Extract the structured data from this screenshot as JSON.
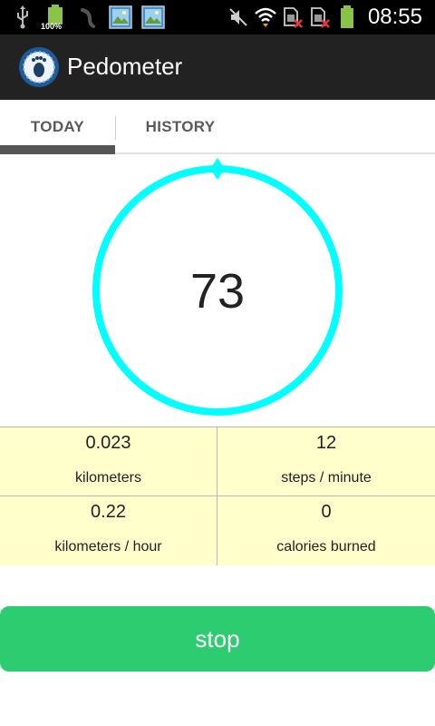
{
  "status_bar": {
    "battery_small_label": "100%",
    "time": "08:55",
    "icons": [
      "usb-icon",
      "battery-full-icon",
      "run-icon",
      "gallery-icon",
      "gallery-icon",
      "mute-icon",
      "wifi-icon",
      "sim-no-signal-icon",
      "sim-no-signal-icon",
      "battery-icon"
    ]
  },
  "action_bar": {
    "title": "Pedometer",
    "icon": "footprint-gauge-icon"
  },
  "tabs": [
    {
      "label": "TODAY",
      "selected": true
    },
    {
      "label": "HISTORY",
      "selected": false
    }
  ],
  "gauge": {
    "steps": "73",
    "progress": 1.0,
    "color": "#00ffff"
  },
  "stats": [
    {
      "value": "0.023",
      "label": "kilometers"
    },
    {
      "value": "12",
      "label": "steps / minute"
    },
    {
      "value": "0.22",
      "label": "kilometers / hour"
    },
    {
      "value": "0",
      "label": "calories burned"
    }
  ],
  "stop_button": {
    "label": "stop"
  },
  "colors": {
    "action_bar": "#222222",
    "stats_bg": "#ffffcc",
    "stop_button": "#2ecc71",
    "gauge_ring": "#00ffff"
  }
}
